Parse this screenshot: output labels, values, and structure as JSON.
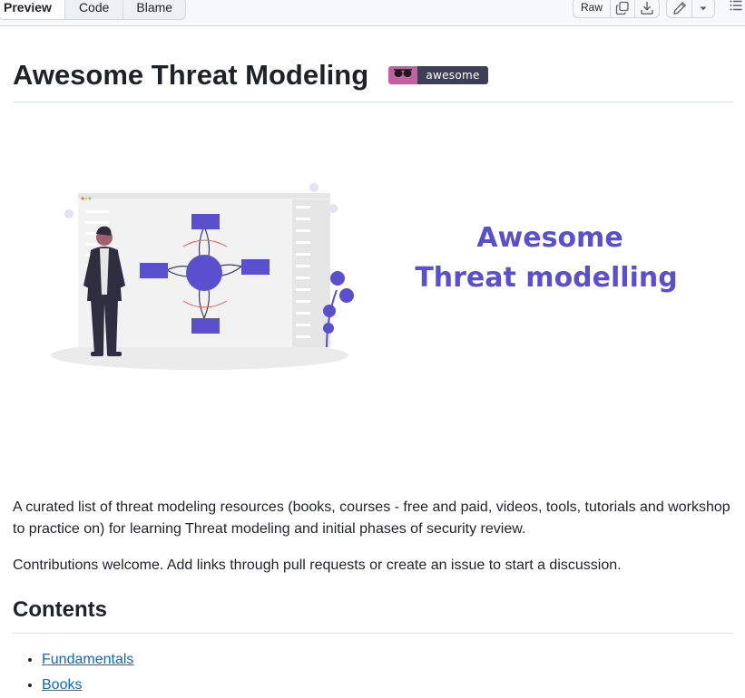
{
  "toolbar": {
    "tabs": [
      {
        "label": "Preview",
        "active": true
      },
      {
        "label": "Code",
        "active": false
      },
      {
        "label": "Blame",
        "active": false
      }
    ],
    "raw_label": "Raw",
    "copy_icon": "copy-icon",
    "download_icon": "download-icon",
    "edit_icon": "pencil-icon",
    "more_icon": "triangle-down-icon",
    "outline_icon": "list-unordered-icon"
  },
  "readme": {
    "title": "Awesome Threat Modeling",
    "badge_text": "awesome",
    "hero": {
      "line1": "Awesome",
      "line2": "Threat modelling"
    },
    "description": "A curated list of threat modeling resources (books, courses - free and paid, videos, tools, tutorials and workshop to practice on) for learning Threat modeling and initial phases of security review.",
    "contributions": "Contributions welcome. Add links through pull requests or create an issue to start a discussion.",
    "contents_heading": "Contents",
    "contents": [
      "Fundamentals",
      "Books"
    ]
  },
  "colors": {
    "link": "#0969da",
    "hero_accent": "#5a4fcf",
    "badge_pink": "#c3609e",
    "badge_dark": "#3e3e58"
  }
}
